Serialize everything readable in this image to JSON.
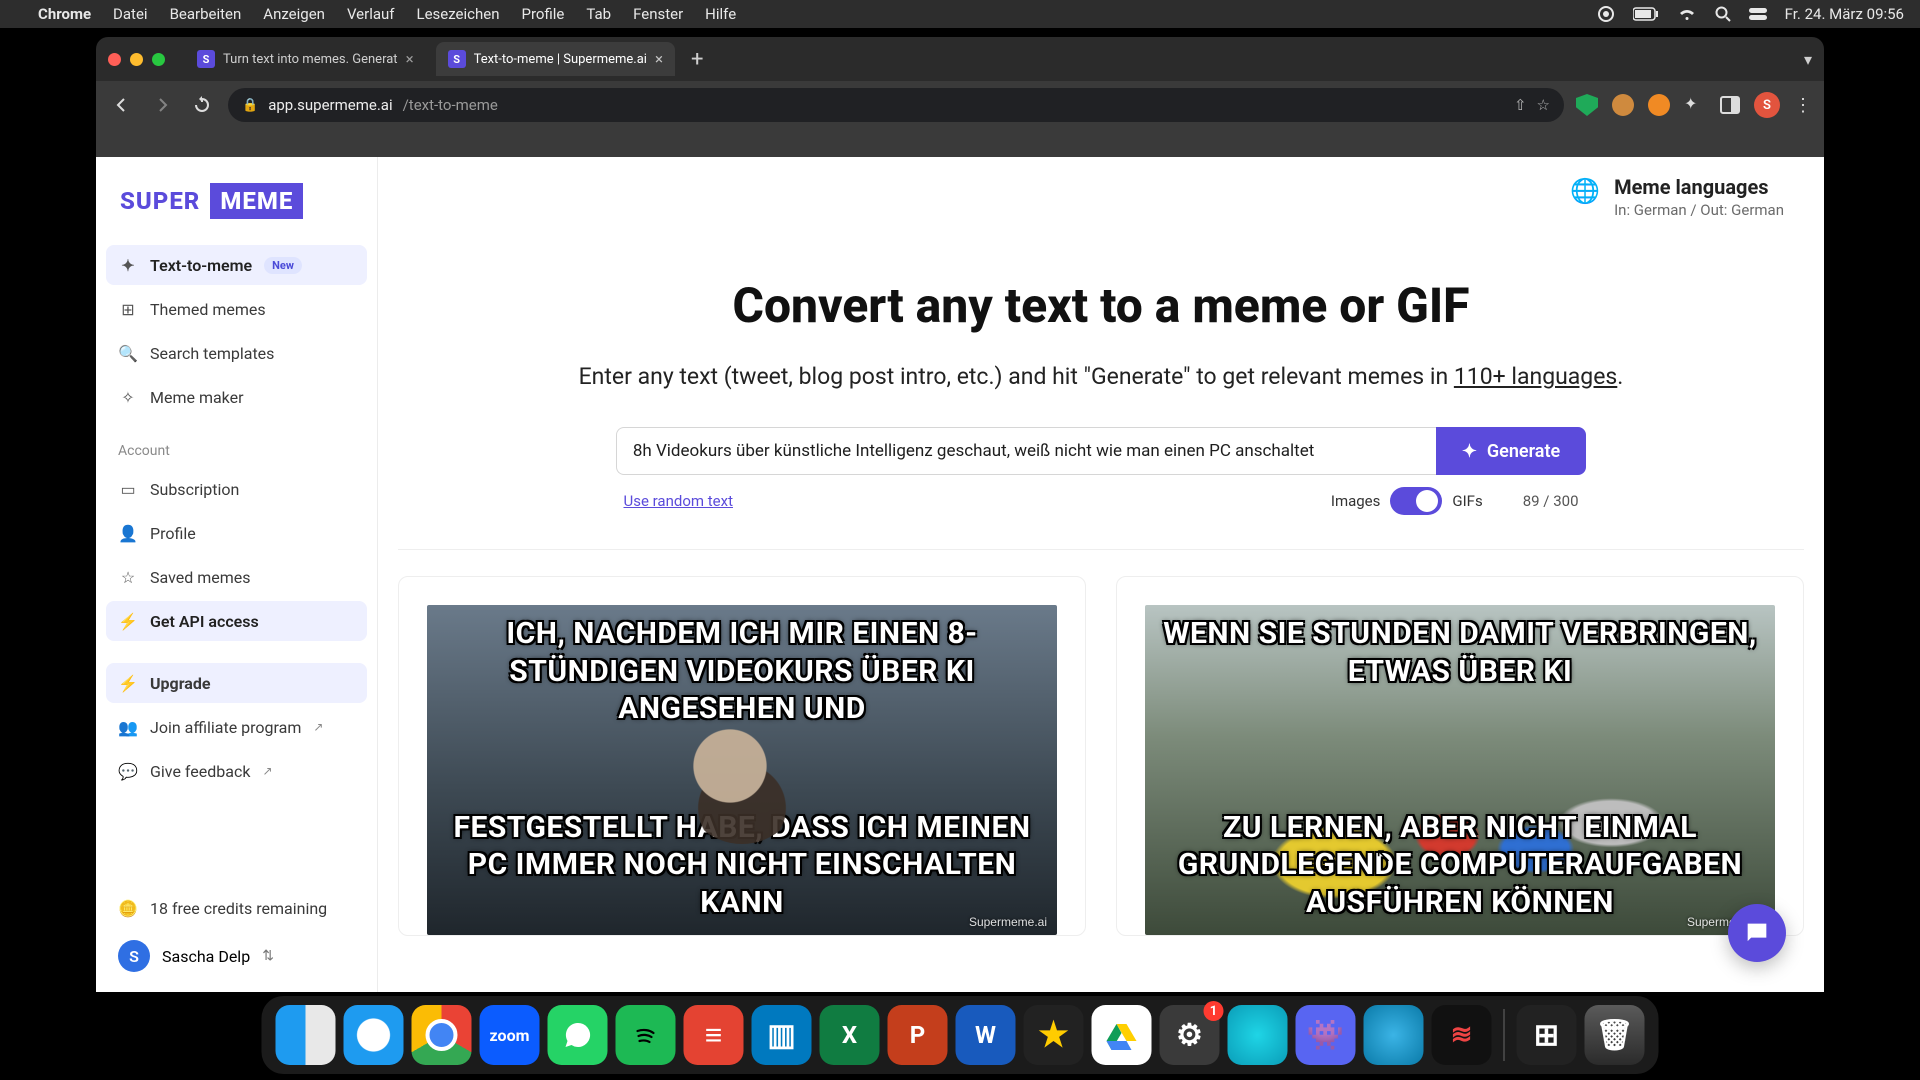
{
  "menubar": {
    "app": "Chrome",
    "items": [
      "Datei",
      "Bearbeiten",
      "Anzeigen",
      "Verlauf",
      "Lesezeichen",
      "Profile",
      "Tab",
      "Fenster",
      "Hilfe"
    ],
    "clock": "Fr. 24. März  09:56"
  },
  "tabs": [
    {
      "favicon": "S",
      "label": "Turn text into memes. Generat",
      "active": false
    },
    {
      "favicon": "S",
      "label": "Text-to-meme | Supermeme.ai",
      "active": true
    }
  ],
  "omnibox": {
    "domain": "app.supermeme.ai",
    "path": "/text-to-meme"
  },
  "logo": {
    "left": "SUPER",
    "right": "MEME"
  },
  "nav": {
    "primary": [
      {
        "icon": "✦",
        "label": "Text-to-meme",
        "badge": "New",
        "active": true
      },
      {
        "icon": "⊞",
        "label": "Themed memes"
      },
      {
        "icon": "🔍",
        "label": "Search templates"
      },
      {
        "icon": "✧",
        "label": "Meme maker"
      }
    ],
    "account_label": "Account",
    "account": [
      {
        "icon": "▭",
        "label": "Subscription"
      },
      {
        "icon": "👤",
        "label": "Profile"
      },
      {
        "icon": "☆",
        "label": "Saved memes"
      },
      {
        "icon": "⚡",
        "label": "Get API access",
        "hl": true
      }
    ],
    "upgrade": {
      "icon": "⚡",
      "label": "Upgrade"
    },
    "extra": [
      {
        "icon": "👥",
        "label": "Join affiliate program",
        "ext": true
      },
      {
        "icon": "💬",
        "label": "Give feedback",
        "ext": true
      }
    ],
    "credits": {
      "icon": "🪙",
      "label": "18 free credits remaining"
    }
  },
  "user": {
    "initial": "S",
    "name": "Sascha Delp"
  },
  "lang": {
    "title": "Meme languages",
    "sub": "In: German / Out: German"
  },
  "hero": {
    "title": "Convert any text to a meme or GIF",
    "sub_a": "Enter any text (tweet, blog post intro, etc.) and hit \"Generate\" to get relevant memes in ",
    "sub_link": "110+ languages",
    "sub_b": "."
  },
  "form": {
    "value": "8h Videokurs über künstliche Intelligenz geschaut, weiß nicht wie man einen PC anschaltet",
    "generate": "Generate",
    "random": "Use random text",
    "toggle_left": "Images",
    "toggle_right": "GIFs",
    "counter": "89 / 300"
  },
  "memes": [
    {
      "top": "ICH, NACHDEM ICH MIR EINEN 8-STÜNDIGEN VIDEOKURS ÜBER KI ANGESEHEN UND",
      "bottom": "FESTGESTELLT HABE, DASS ICH MEINEN PC IMMER NOCH NICHT EINSCHALTEN KANN",
      "watermark": "Supermeme.ai"
    },
    {
      "top": "WENN SIE STUNDEN DAMIT VERBRINGEN, ETWAS ÜBER KI",
      "bottom": "ZU LERNEN, ABER NICHT EINMAL GRUNDLEGENDE COMPUTERAUFGABEN AUSFÜHREN KÖNNEN",
      "watermark": "Supermeme.ai"
    }
  ],
  "dock": {
    "zoom": "zoom",
    "excel": "X",
    "ppt": "P",
    "word": "W",
    "settings_badge": "1"
  },
  "avatar_initial": "S"
}
